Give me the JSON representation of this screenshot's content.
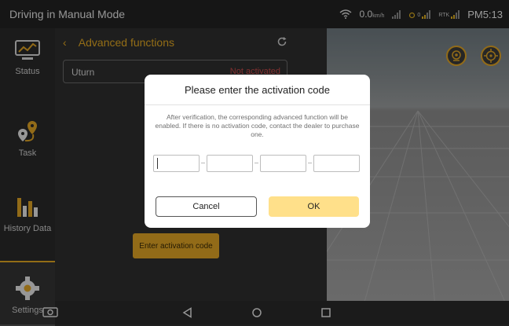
{
  "status_bar": {
    "title": "Driving in Manual Mode",
    "speed": "0.0",
    "speed_unit": "km/h",
    "rtk_label": "RTK",
    "sat_count": "0",
    "time": "PM5:13"
  },
  "sidebar": {
    "items": [
      {
        "label": "Status",
        "icon": "monitor-icon"
      },
      {
        "label": "Task",
        "icon": "route-pin-icon"
      },
      {
        "label": "History Data",
        "icon": "bar-chart-icon"
      },
      {
        "label": "Settings",
        "icon": "gear-icon"
      }
    ]
  },
  "panel": {
    "back_glyph": "‹",
    "title": "Advanced functions",
    "row_label": "Uturn",
    "row_status": "Not activated",
    "enter_button": "Enter activation code"
  },
  "dialog": {
    "title": "Please enter the activation code",
    "description": "After verification, the corresponding advanced function will be enabled. If there is no activation code, contact the dealer to purchase one.",
    "cancel": "Cancel",
    "ok": "OK"
  },
  "colors": {
    "accent": "#e0a526",
    "ok_button": "#ffe08a",
    "dark_bg": "#2f2f2f"
  }
}
